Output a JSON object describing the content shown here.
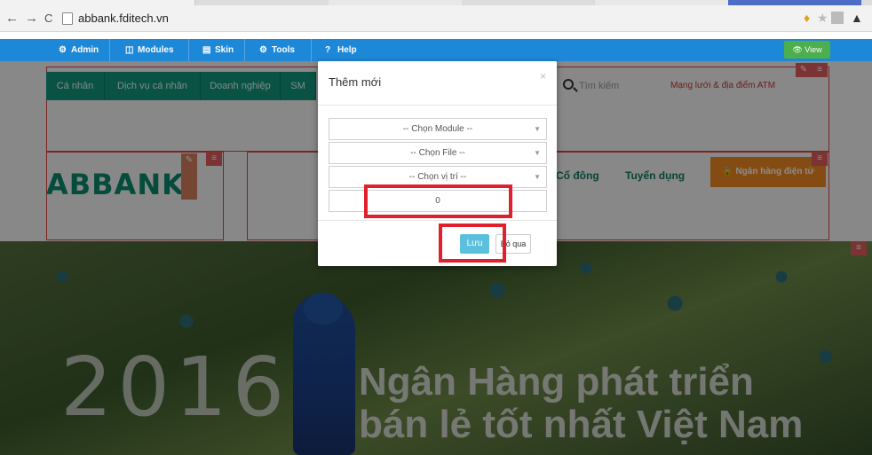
{
  "browser": {
    "back": "←",
    "forward": "→",
    "reload": "C",
    "url": "abbank.fditech.vn"
  },
  "admin_bar": {
    "items": [
      {
        "icon": "⚙",
        "label": "Admin"
      },
      {
        "icon": "◫",
        "label": "Modules"
      },
      {
        "icon": "▤",
        "label": "Skin"
      },
      {
        "icon": "⚙",
        "label": "Tools"
      },
      {
        "icon": "?",
        "label": "Help"
      }
    ],
    "view_label": "View"
  },
  "site": {
    "topnav": [
      "Cá nhân",
      "Dịch vụ cá nhân",
      "Doanh nghiệp",
      "SM"
    ],
    "search_placeholder": "Tìm kiếm",
    "atm_link": "Mạng lưới & địa điểm ATM",
    "logo": "ABBANK",
    "menu": [
      "Cổ đông",
      "Tuyển dụng"
    ],
    "ebank_label": "Ngân hàng điện tử",
    "hero_year": "2016",
    "hero_line1": "Ngân Hàng phát triển",
    "hero_line2": "bán lẻ tốt nhất Việt Nam"
  },
  "modal": {
    "title": "Thêm mới",
    "close": "×",
    "module_select": "-- Chọn Module --",
    "file_select": "-- Chọn File --",
    "position_select": "-- Chọn vị trí --",
    "order_value": "0",
    "save_label": "Lưu",
    "skip_label": "Bỏ qua"
  }
}
